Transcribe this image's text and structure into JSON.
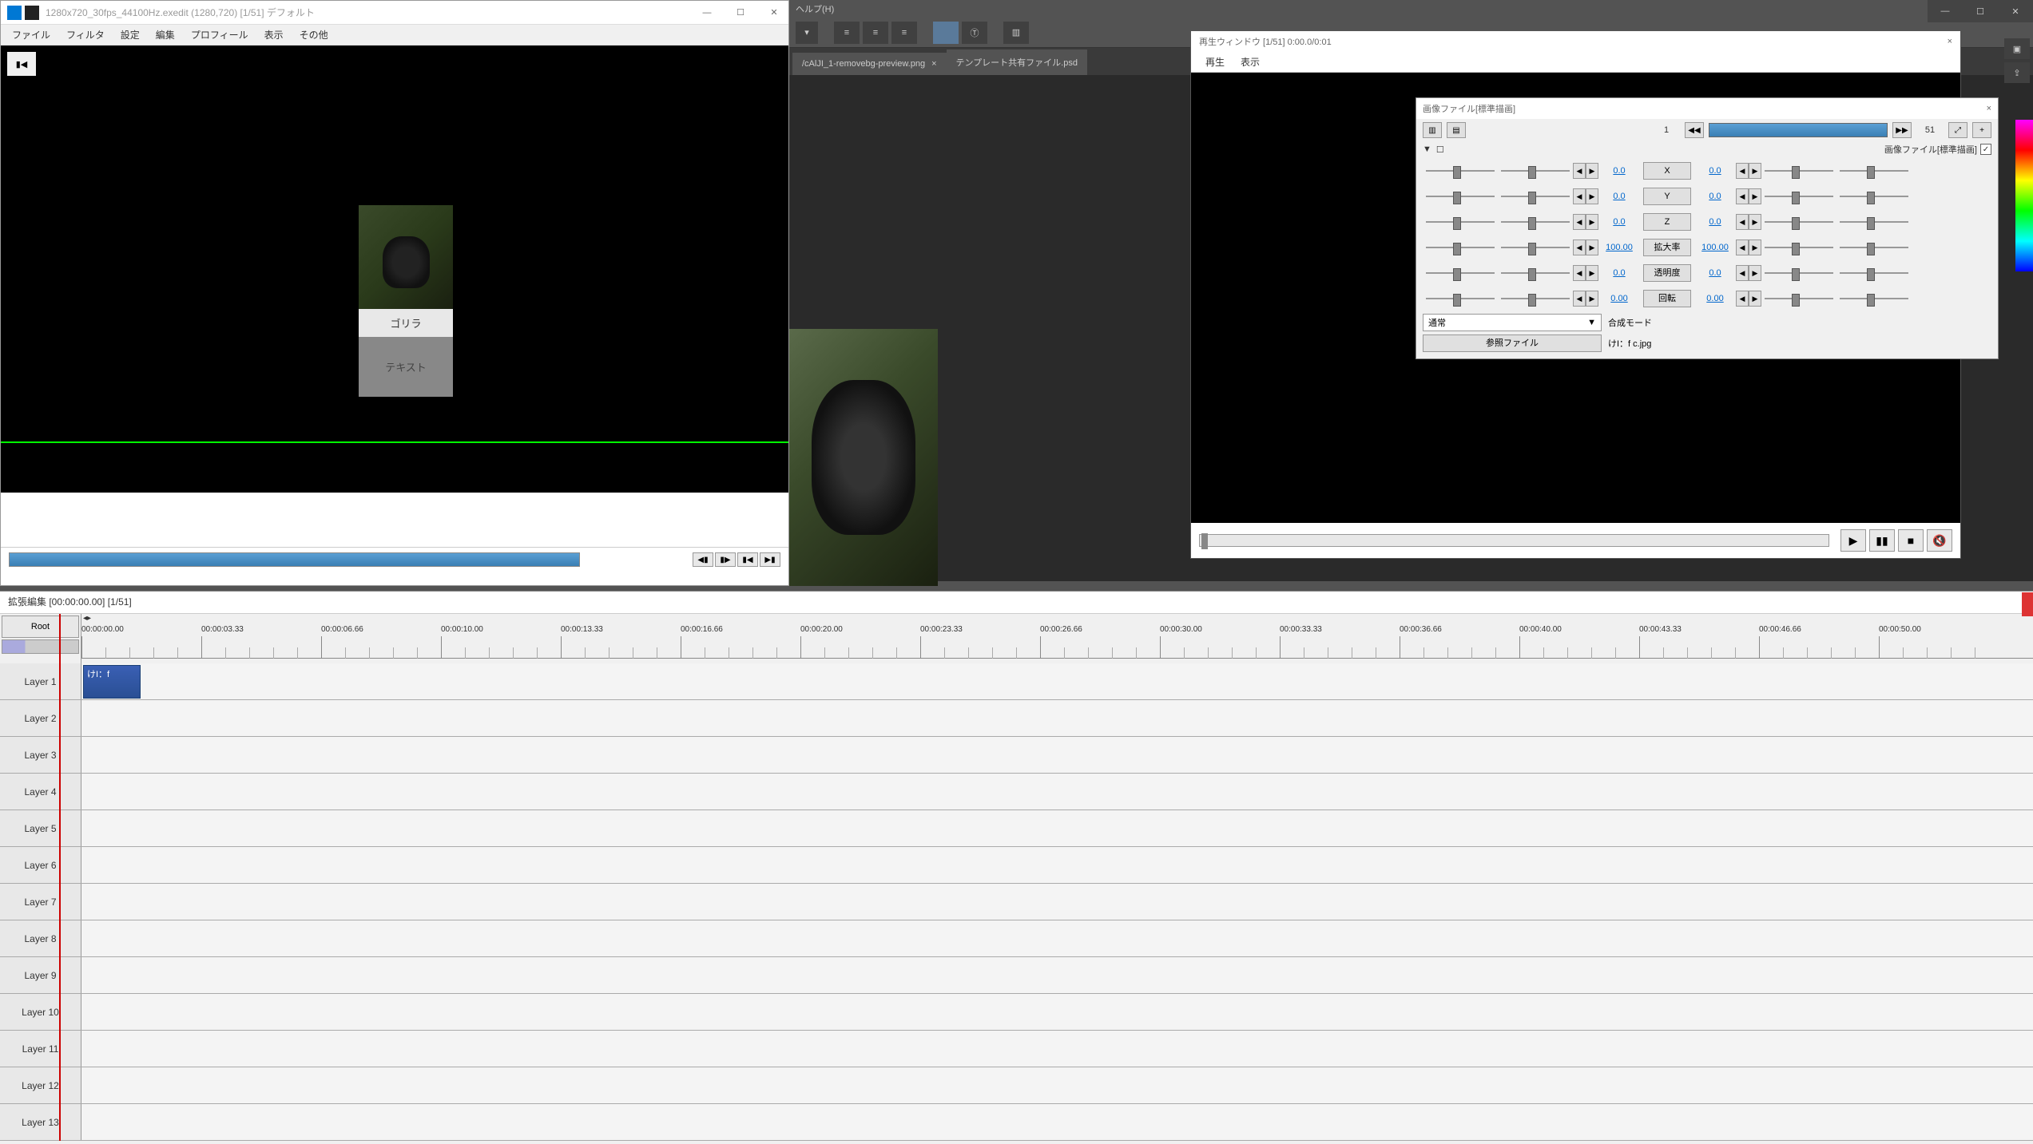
{
  "main": {
    "title": "1280x720_30fps_44100Hz.exedit (1280,720)  [1/51]  デフォルト",
    "menu": [
      "ファイル",
      "フィルタ",
      "設定",
      "編集",
      "プロフィール",
      "表示",
      "その他"
    ],
    "card": {
      "label": "ゴリラ",
      "text": "テキスト"
    },
    "seek_btns": [
      "◀▮",
      "▮▶",
      "▮◀",
      "▶▮"
    ]
  },
  "ps": {
    "help": "ヘルプ(H)",
    "tabs": [
      {
        "name": "/cAlJI_1-removebg-preview.png"
      },
      {
        "name": "テンプレート共有ファイル.psd"
      }
    ]
  },
  "playback": {
    "title": "再生ウィンドウ  [1/51]  0:00.0/0:01",
    "menu": [
      "再生",
      "表示"
    ],
    "btns": {
      "play": "▶",
      "pause": "▮▮",
      "stop": "■",
      "mute": "🔇"
    }
  },
  "prop": {
    "title": "画像ファイル[標準描画]",
    "frame_start": "1",
    "frame_end": "51",
    "subline_label": "画像ファイル[標準描画]",
    "rows": [
      {
        "label": "X",
        "v1": "0.0",
        "v2": "0.0"
      },
      {
        "label": "Y",
        "v1": "0.0",
        "v2": "0.0"
      },
      {
        "label": "Z",
        "v1": "0.0",
        "v2": "0.0"
      },
      {
        "label": "拡大率",
        "v1": "100.00",
        "v2": "100.00"
      },
      {
        "label": "透明度",
        "v1": "0.0",
        "v2": "0.0"
      },
      {
        "label": "回転",
        "v1": "0.00",
        "v2": "0.00"
      }
    ],
    "blend_label": "合成モード",
    "blend_value": "通常",
    "file_btn": "参照ファイル",
    "file_name": "けI：f c.jpg"
  },
  "timeline": {
    "title": "拡張編集 [00:00:00.00] [1/51]",
    "root": "Root",
    "ticks": [
      "00:00:00.00",
      "00:00:03.33",
      "00:00:06.66",
      "00:00:10.00",
      "00:00:13.33",
      "00:00:16.66",
      "00:00:20.00",
      "00:00:23.33",
      "00:00:26.66",
      "00:00:30.00",
      "00:00:33.33",
      "00:00:36.66",
      "00:00:40.00",
      "00:00:43.33",
      "00:00:46.66",
      "00:00:50.00"
    ],
    "layers": [
      "Layer 1",
      "Layer 2",
      "Layer 3",
      "Layer 4",
      "Layer 5",
      "Layer 6",
      "Layer 7",
      "Layer 8",
      "Layer 9",
      "Layer 10",
      "Layer 11",
      "Layer 12",
      "Layer 13"
    ],
    "clip": "けI：f"
  },
  "winbtns": {
    "min": "—",
    "max": "☐",
    "close": "✕"
  }
}
